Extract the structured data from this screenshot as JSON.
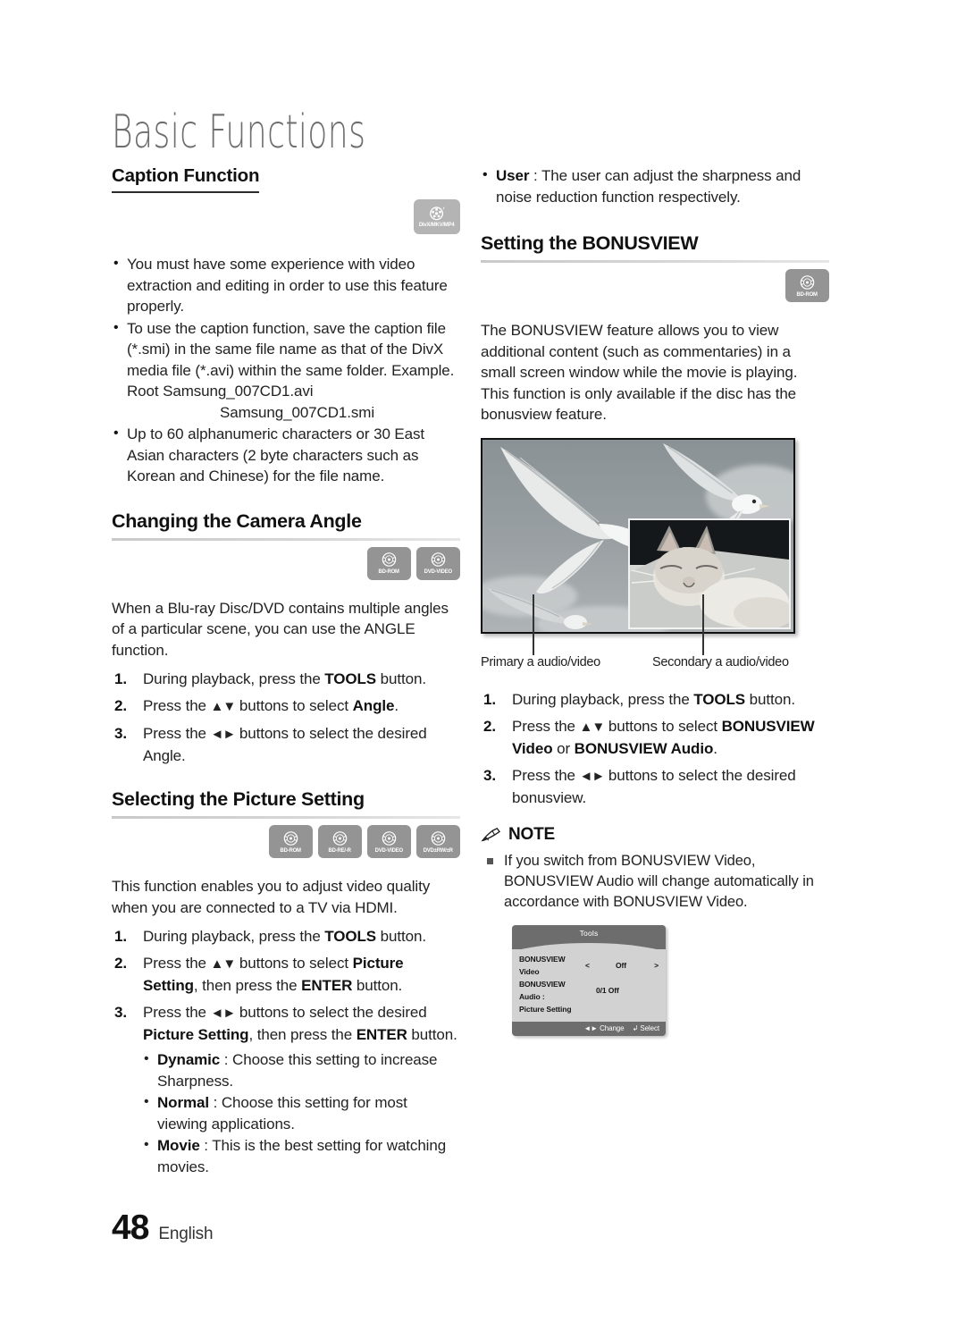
{
  "chapter": {
    "title": "Basic Functions"
  },
  "footer": {
    "page_number": "48",
    "language": "English"
  },
  "left_column": {
    "caption_function": {
      "heading": "Caption Function",
      "badges": [
        {
          "label": "DivX/MKV/MP4",
          "icon": "film-reel-icon",
          "style": "light"
        }
      ],
      "bullets": [
        "You must have some experience with video extraction and editing in order to use this feature properly.",
        "To use the caption function, save the caption file (*.smi) in the same file name as that of the DivX media file (*.avi) within the same folder.",
        "Up to 60 alphanumeric characters or 30 East Asian characters (2 byte characters such as Korean and Chinese) for the file name."
      ],
      "example_line1": "Example. Root Samsung_007CD1.avi",
      "example_line2": "Samsung_007CD1.smi"
    },
    "camera_angle": {
      "heading": "Changing the Camera Angle",
      "badges": [
        {
          "label": "BD-ROM",
          "icon": "disc-icon"
        },
        {
          "label": "DVD-VIDEO",
          "icon": "disc-icon"
        }
      ],
      "intro": "When a Blu-ray Disc/DVD contains multiple angles of a particular scene, you can use the ANGLE function.",
      "steps": [
        {
          "pre": "During playback, press the ",
          "bold": "TOOLS",
          "post": " button."
        },
        {
          "pre": "Press the ",
          "arrows": "▲▼",
          "mid": " buttons to select ",
          "bold": "Angle",
          "post": "."
        },
        {
          "pre": "Press the ",
          "arrows": "◄►",
          "mid": " buttons to select the desired Angle.",
          "bold": "",
          "post": ""
        }
      ]
    },
    "picture_setting": {
      "heading": "Selecting the Picture Setting",
      "badges": [
        {
          "label": "BD-ROM",
          "icon": "disc-icon"
        },
        {
          "label": "BD-RE/-R",
          "icon": "disc-icon"
        },
        {
          "label": "DVD-VIDEO",
          "icon": "disc-icon"
        },
        {
          "label": "DVD±RW/±R",
          "icon": "disc-icon"
        }
      ],
      "intro": "This function enables you to adjust video quality when you are connected to a TV via HDMI.",
      "step1_pre": "During playback, press the ",
      "step1_bold": "TOOLS",
      "step1_post": " button.",
      "step2_pre": "Press the ",
      "step2_arrows": "▲▼",
      "step2_mid": " buttons to select ",
      "step2_bold1": "Picture Setting",
      "step2_mid2": ", then press the ",
      "step2_bold2": "ENTER",
      "step2_post": " button.",
      "step3_pre": "Press the ",
      "step3_arrows": "◄►",
      "step3_mid": " buttons to select the desired ",
      "step3_bold1": "Picture Setting",
      "step3_mid2": ", then press the ",
      "step3_bold2": "ENTER",
      "step3_post": " button.",
      "options": [
        {
          "name": "Dynamic",
          "desc": " : Choose this setting to increase Sharpness."
        },
        {
          "name": "Normal",
          "desc": " : Choose this setting for most viewing applications."
        },
        {
          "name": "Movie",
          "desc": " : This is the best setting for watching movies."
        }
      ]
    }
  },
  "right_column": {
    "user_option": {
      "name": "User",
      "desc": " : The user can adjust the sharpness and noise reduction function respectively."
    },
    "bonusview": {
      "heading": "Setting the BONUSVIEW",
      "badges": [
        {
          "label": "BD-ROM",
          "icon": "disc-icon"
        }
      ],
      "intro": "The BONUSVIEW feature allows you to view additional content (such as commentaries) in a small screen window while the movie is playing. This function is only available if the disc has the bonusview feature.",
      "figure": {
        "primary_caption": "Primary a audio/video",
        "secondary_caption": "Secondary a audio/video"
      },
      "step1_pre": "During playback, press the ",
      "step1_bold": "TOOLS",
      "step1_post": " button.",
      "step2_pre": "Press the ",
      "step2_arrows": "▲▼",
      "step2_mid": " buttons to select ",
      "step2_bold1": "BONUSVIEW Video",
      "step2_mid2": " or ",
      "step2_bold2": "BONUSVIEW Audio",
      "step2_post": ".",
      "step3_pre": "Press the ",
      "step3_arrows": "◄►",
      "step3_mid": " buttons to select the desired bonusview."
    },
    "note": {
      "icon": "pencil-icon",
      "title": "NOTE",
      "items": [
        "If you switch from BONUSVIEW Video, BONUSVIEW Audio will change automatically in accordance with BONUSVIEW Video."
      ]
    },
    "osd": {
      "title": "Tools",
      "rows": [
        {
          "label": "BONUSVIEW Video",
          "left_arrow": "<",
          "value": "Off",
          "right_arrow": ">"
        },
        {
          "label": "BONUSVIEW Audio :",
          "left_arrow": "",
          "value": "0/1 Off",
          "right_arrow": ""
        },
        {
          "label": "Picture Setting",
          "left_arrow": "",
          "value": "",
          "right_arrow": ""
        }
      ],
      "footer_change": "◄► Change",
      "footer_select": "↲ Select"
    }
  },
  "colors": {
    "badge_gray": "#949494",
    "badge_light_gray": "#b4b4b4",
    "osd_bar": "#6d6d6d",
    "osd_body": "#d2d2d2",
    "heading_rule": "#2b2b2b",
    "chapter_title": "#6e6e6e"
  }
}
